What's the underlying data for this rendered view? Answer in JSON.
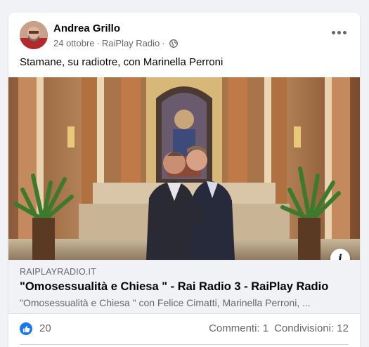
{
  "post": {
    "author": "Andrea Grillo",
    "date": "24 ottobre",
    "separator": "·",
    "page": "RaiPlay Radio",
    "text": "Stamane, su radiotre, con Marinella Perroni",
    "menu_icon": "more-options-icon",
    "privacy_icon": "globe-icon"
  },
  "link_preview": {
    "domain": "RAIPLAYRADIO.IT",
    "title": "\"Omosessualità e Chiesa \" - Rai Radio 3 - RaiPlay Radio",
    "description": "\"Omosessualità e Chiesa \" con Felice Cimatti, Marinella Perroni, ...",
    "info_icon": "info-icon"
  },
  "reactions": {
    "like_count": "20",
    "comments": "Commenti: 1",
    "shares": "Condivisioni: 12"
  },
  "colors": {
    "accent": "#1877f2",
    "secondary_text": "#65676b",
    "background": "#f0f2f5"
  }
}
